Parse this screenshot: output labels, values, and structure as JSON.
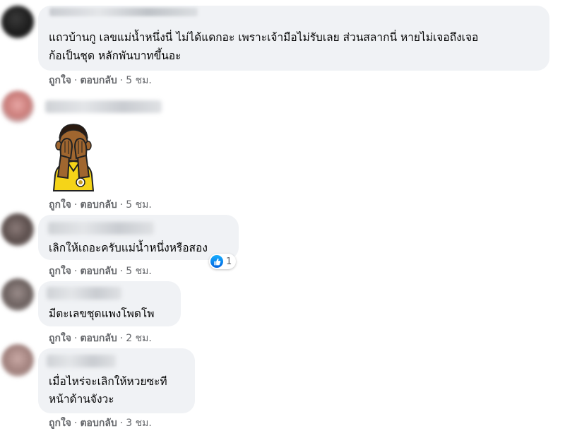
{
  "comments": [
    {
      "lines": [
        "แถวบ้านกู เลขแม่น้ำหนึ่งนี่ ไม่ได้แดกอะ เพราะเจ้ามือไม่รับเลย ส่วนสลากนี่ หายไม่เจอถึงเจอ",
        "ก้อเป็นชุด หลักพันบาทขึ้นอะ"
      ],
      "like_label": "ถูกใจ",
      "reply_label": "ตอบกลับ",
      "time": "5 ชม."
    },
    {
      "sticker": "hands-over-eyes-sticker",
      "like_label": "ถูกใจ",
      "reply_label": "ตอบกลับ",
      "time": "5 ชม."
    },
    {
      "lines": [
        "เลิกให้เถอะครับแม่น้ำหนึ่งหรือสอง"
      ],
      "like_label": "ถูกใจ",
      "reply_label": "ตอบกลับ",
      "time": "5 ชม.",
      "reaction_count": "1"
    },
    {
      "lines": [
        "มีตะเลขชุดแพงโพดโพ"
      ],
      "like_label": "ถูกใจ",
      "reply_label": "ตอบกลับ",
      "time": "2 ชม."
    },
    {
      "lines": [
        "เมื่อไหร่จะเลิกให้หวยซะที",
        "หน้าด้านจังวะ"
      ],
      "like_label": "ถูกใจ",
      "reply_label": "ตอบกลับ",
      "time": "3 ชม."
    }
  ],
  "colors": {
    "bubble": "#f0f2f5",
    "meta": "#65676b",
    "like_blue": "#1877f2"
  },
  "icons": {
    "reaction": "like-thumb-icon",
    "avatar": "blurred-avatar"
  }
}
